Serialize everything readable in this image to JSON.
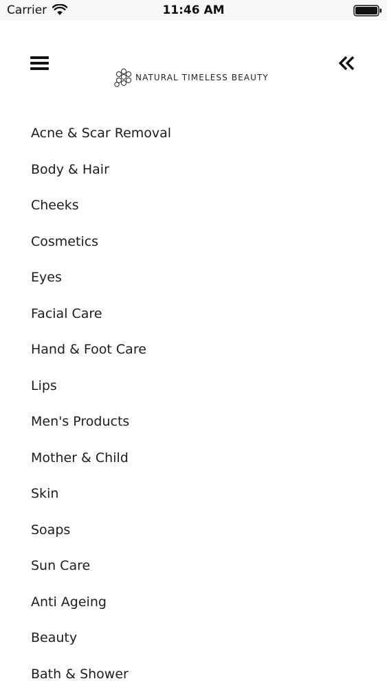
{
  "status_bar": {
    "carrier": "Carrier",
    "time": "11:46 AM"
  },
  "header": {
    "logo_text": "NATURAL TIMELESS BEAUTY",
    "menu_icon": "hamburger-icon",
    "collapse_icon": "double-chevron-left-icon"
  },
  "menu": {
    "items": [
      {
        "label": "Acne & Scar Removal"
      },
      {
        "label": "Body & Hair"
      },
      {
        "label": "Cheeks"
      },
      {
        "label": "Cosmetics"
      },
      {
        "label": "Eyes"
      },
      {
        "label": "Facial Care"
      },
      {
        "label": "Hand & Foot Care"
      },
      {
        "label": "Lips"
      },
      {
        "label": "Men's Products"
      },
      {
        "label": "Mother & Child"
      },
      {
        "label": "Skin"
      },
      {
        "label": "Soaps"
      },
      {
        "label": "Sun Care"
      },
      {
        "label": "Anti Ageing"
      },
      {
        "label": "Beauty"
      },
      {
        "label": "Bath & Shower"
      }
    ]
  }
}
